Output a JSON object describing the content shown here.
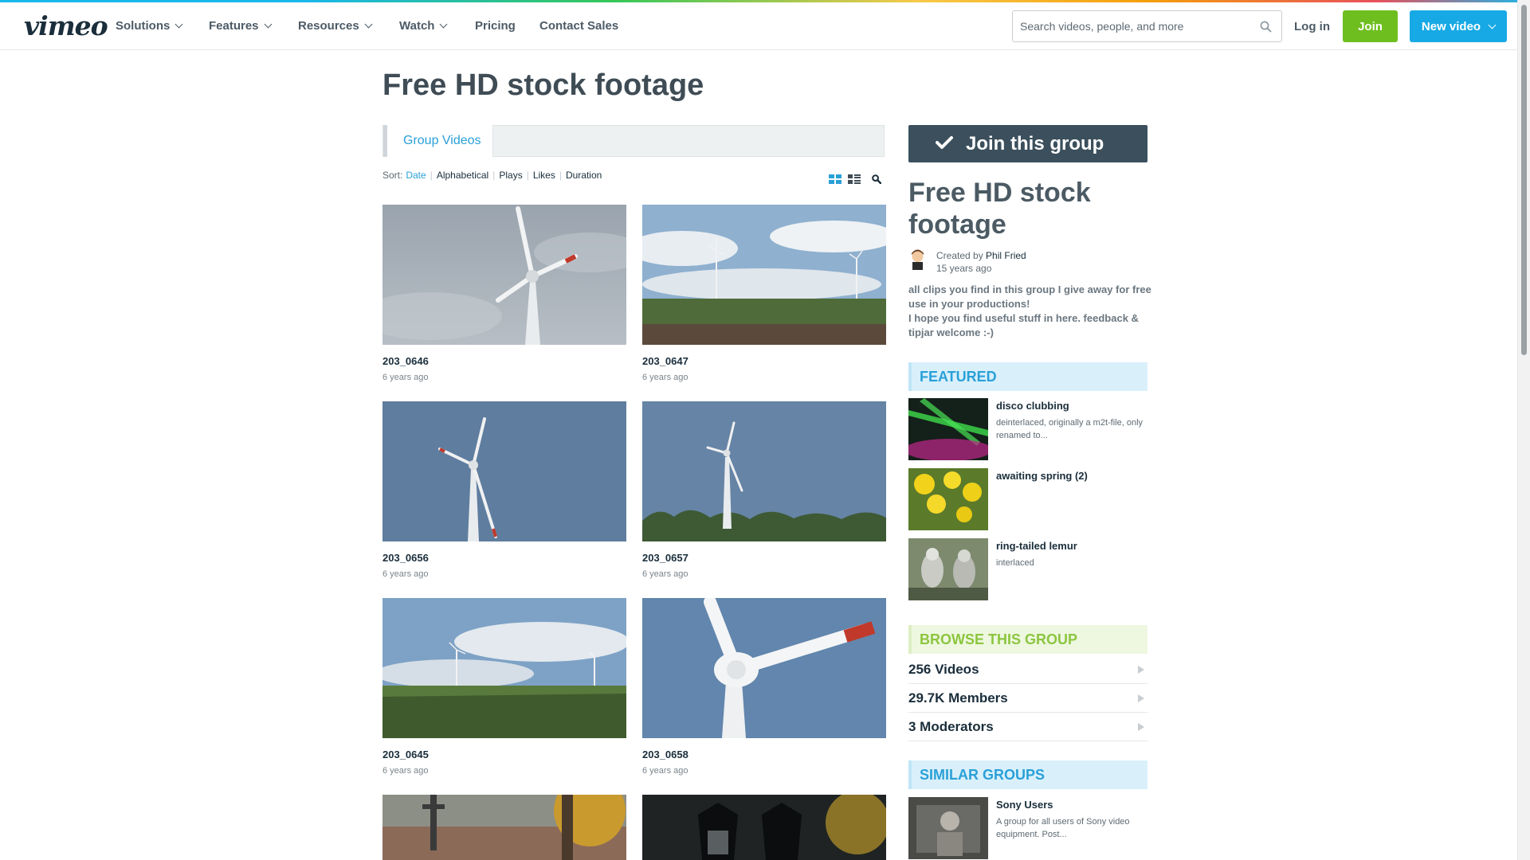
{
  "header": {
    "logo": "vimeo",
    "nav": [
      {
        "label": "Solutions",
        "dropdown": true
      },
      {
        "label": "Features",
        "dropdown": true
      },
      {
        "label": "Resources",
        "dropdown": true
      },
      {
        "label": "Watch",
        "dropdown": true
      },
      {
        "label": "Pricing",
        "dropdown": false
      },
      {
        "label": "Contact Sales",
        "dropdown": false
      }
    ],
    "search_placeholder": "Search videos, people, and more",
    "login": "Log in",
    "join": "Join",
    "new_video": "New video"
  },
  "page": {
    "title": "Free HD stock footage",
    "tab": "Group Videos",
    "sort": {
      "label": "Sort:",
      "options": [
        "Date",
        "Alphabetical",
        "Plays",
        "Likes",
        "Duration"
      ],
      "active": "Date"
    },
    "videos": [
      {
        "title": "203_0646",
        "date": "6 years ago",
        "scene": "turbine-cloudy"
      },
      {
        "title": "203_0647",
        "date": "6 years ago",
        "scene": "field-turbines"
      },
      {
        "title": "203_0656",
        "date": "6 years ago",
        "scene": "turbine-blue"
      },
      {
        "title": "203_0657",
        "date": "6 years ago",
        "scene": "turbine-trees"
      },
      {
        "title": "203_0645",
        "date": "6 years ago",
        "scene": "field-corn"
      },
      {
        "title": "203_0658",
        "date": "6 years ago",
        "scene": "turbine-closeup"
      },
      {
        "title": "",
        "date": "",
        "scene": "cemetery"
      },
      {
        "title": "",
        "date": "",
        "scene": "lanterns"
      }
    ]
  },
  "sidebar": {
    "join_button": "Join this group",
    "title": "Free HD stock footage",
    "created_by_label": "Created by",
    "creator": "Phil Fried",
    "created_ago": "15 years ago",
    "description": "all clips you find in this group I give away for free use in your productions!\nI hope you find useful stuff in here. feedback & tipjar welcome :-)",
    "featured_heading": "FEATURED",
    "featured": [
      {
        "title": "disco clubbing",
        "subtitle": "deinterlaced, originally a m2t-file, only renamed to..."
      },
      {
        "title": "awaiting spring (2)",
        "subtitle": ""
      },
      {
        "title": "ring-tailed lemur",
        "subtitle": "interlaced"
      }
    ],
    "browse_heading": "BROWSE THIS GROUP",
    "browse": [
      {
        "label": "256 Videos"
      },
      {
        "label": "29.7K Members"
      },
      {
        "label": "3 Moderators"
      }
    ],
    "similar_heading": "SIMILAR GROUPS",
    "similar": [
      {
        "title": "Sony Users",
        "subtitle": "A group for all users of Sony video equipment. Post..."
      }
    ]
  },
  "colors": {
    "accent_blue": "#17a9e5",
    "join_green": "#6fbe1f",
    "heading_blue": "#2aa0d8",
    "heading_green": "#8cc63f",
    "dark_button": "#3b4f5c"
  }
}
